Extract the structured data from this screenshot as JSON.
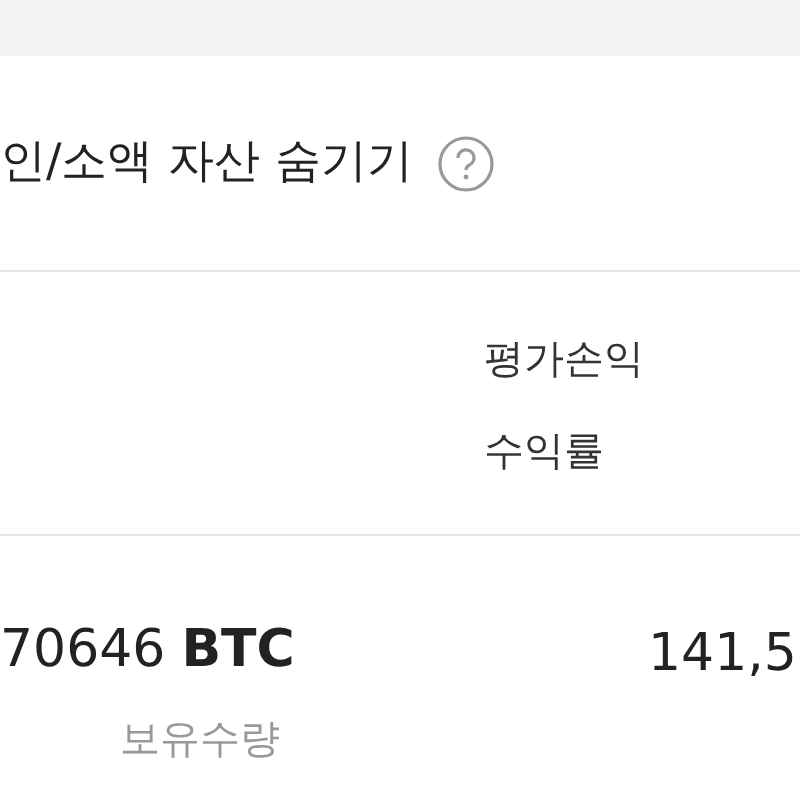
{
  "hide_option": {
    "label": "인/소액 자산 숨기기"
  },
  "columns": [
    {
      "label": "평가손익"
    },
    {
      "label": "수익률"
    }
  ],
  "holding": {
    "amount": "70646",
    "unit": "BTC",
    "caption": "보유수량",
    "value": "141,5"
  }
}
